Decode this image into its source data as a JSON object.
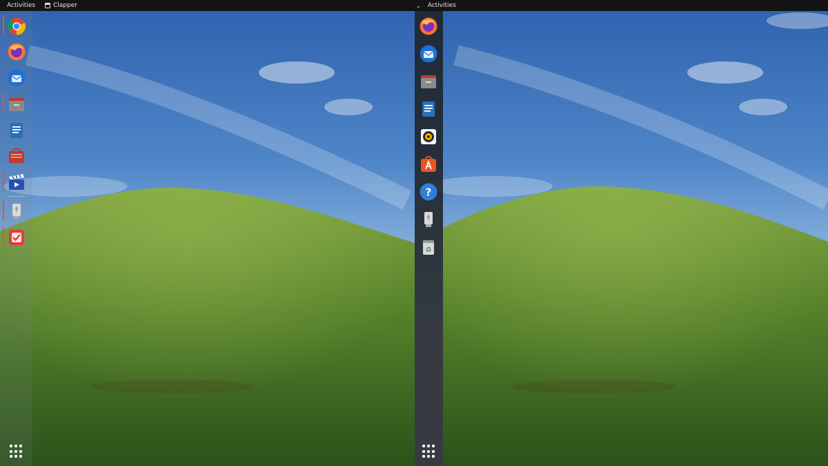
{
  "screens": {
    "left": {
      "topbar": {
        "activities_label": "Activities",
        "app_name": "Clapper"
      },
      "dock_items": [
        {
          "name": "google-chrome",
          "icon": "chrome-icon",
          "running": true
        },
        {
          "name": "firefox",
          "icon": "firefox-icon",
          "running": false
        },
        {
          "name": "thunderbird",
          "icon": "thunderbird-icon",
          "running": false
        },
        {
          "name": "files",
          "icon": "folder-icon",
          "running": true
        },
        {
          "name": "libreoffice-writer",
          "icon": "writer-icon",
          "running": false
        },
        {
          "name": "app-center",
          "icon": "shopping-bag-icon",
          "running": false
        },
        {
          "name": "clapper",
          "icon": "clapper-icon",
          "running": true
        },
        {
          "name": "usb-drive",
          "icon": "usb-drive-icon",
          "running": true
        },
        {
          "name": "todo",
          "icon": "checklist-icon",
          "running": true
        }
      ]
    },
    "right": {
      "topbar": {
        "activities_label": "Activities",
        "dropdown_glyph": "⌄"
      },
      "dock_items": [
        {
          "name": "firefox",
          "icon": "firefox-icon"
        },
        {
          "name": "thunderbird",
          "icon": "thunderbird-icon"
        },
        {
          "name": "files",
          "icon": "folder-icon"
        },
        {
          "name": "libreoffice-writer",
          "icon": "writer-icon"
        },
        {
          "name": "rhythmbox",
          "icon": "speaker-icon"
        },
        {
          "name": "ubuntu-software",
          "icon": "software-store-icon"
        },
        {
          "name": "help",
          "icon": "help-icon",
          "glyph": "?"
        },
        {
          "name": "usb-drive",
          "icon": "usb-drive-icon"
        },
        {
          "name": "trash",
          "icon": "trash-icon",
          "glyph": "♻"
        }
      ]
    }
  },
  "colors": {
    "topbar_bg": "#141414",
    "running_indicator": "#e95420",
    "sky_top": "#2f63b0",
    "sky_horizon": "#b9d3ea",
    "grass_light": "#6f9a3a",
    "grass_dark": "#2f5a1a"
  },
  "wallpaper": "rolling-green-hill-under-blue-sky"
}
